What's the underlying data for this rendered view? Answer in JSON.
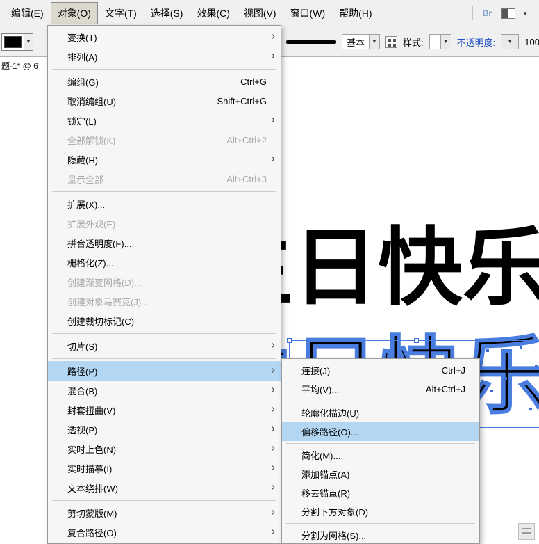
{
  "menubar": {
    "items": [
      {
        "label": "编辑(E)",
        "active": false
      },
      {
        "label": "对象(O)",
        "active": true
      },
      {
        "label": "文字(T)",
        "active": false
      },
      {
        "label": "选择(S)",
        "active": false
      },
      {
        "label": "效果(C)",
        "active": false
      },
      {
        "label": "视图(V)",
        "active": false
      },
      {
        "label": "窗口(W)",
        "active": false
      },
      {
        "label": "帮助(H)",
        "active": false
      }
    ],
    "bridge_label": "Br"
  },
  "control_bar": {
    "brush_name": "基本",
    "style_label": "样式:",
    "opacity_label": "不透明度:",
    "opacity_value": "100"
  },
  "document_tab": {
    "label": "题-1* @ 6"
  },
  "object_menu": {
    "items": [
      {
        "label": "变换(T)",
        "submenu": true
      },
      {
        "label": "排列(A)",
        "submenu": true
      },
      {
        "separator": true
      },
      {
        "label": "编组(G)",
        "shortcut": "Ctrl+G"
      },
      {
        "label": "取消编组(U)",
        "shortcut": "Shift+Ctrl+G"
      },
      {
        "label": "锁定(L)",
        "submenu": true
      },
      {
        "label": "全部解锁(K)",
        "shortcut": "Alt+Ctrl+2",
        "disabled": true
      },
      {
        "label": "隐藏(H)",
        "submenu": true
      },
      {
        "label": "显示全部",
        "shortcut": "Alt+Ctrl+3",
        "disabled": true
      },
      {
        "separator": true
      },
      {
        "label": "扩展(X)..."
      },
      {
        "label": "扩展外观(E)",
        "disabled": true
      },
      {
        "label": "拼合透明度(F)..."
      },
      {
        "label": "栅格化(Z)..."
      },
      {
        "label": "创建渐变网格(D)...",
        "disabled": true
      },
      {
        "label": "创建对象马赛克(J)...",
        "disabled": true
      },
      {
        "label": "创建裁切标记(C)"
      },
      {
        "separator": true
      },
      {
        "label": "切片(S)",
        "submenu": true
      },
      {
        "separator": true
      },
      {
        "label": "路径(P)",
        "submenu": true,
        "highlighted": true
      },
      {
        "label": "混合(B)",
        "submenu": true
      },
      {
        "label": "封套扭曲(V)",
        "submenu": true
      },
      {
        "label": "透视(P)",
        "submenu": true
      },
      {
        "label": "实时上色(N)",
        "submenu": true
      },
      {
        "label": "实时描摹(I)",
        "submenu": true
      },
      {
        "label": "文本绕排(W)",
        "submenu": true
      },
      {
        "separator": true
      },
      {
        "label": "剪切蒙版(M)",
        "submenu": true
      },
      {
        "label": "复合路径(O)",
        "submenu": true
      }
    ]
  },
  "path_submenu": {
    "items": [
      {
        "label": "连接(J)",
        "shortcut": "Ctrl+J"
      },
      {
        "label": "平均(V)...",
        "shortcut": "Alt+Ctrl+J"
      },
      {
        "separator": true
      },
      {
        "label": "轮廓化描边(U)"
      },
      {
        "label": "偏移路径(O)...",
        "highlighted": true
      },
      {
        "separator": true
      },
      {
        "label": "简化(M)..."
      },
      {
        "label": "添加锚点(A)"
      },
      {
        "label": "移去锚点(R)"
      },
      {
        "label": "分割下方对象(D)"
      },
      {
        "separator": true
      },
      {
        "label": "分割为网格(S)..."
      }
    ]
  },
  "canvas": {
    "headline_text": "生日快乐",
    "outline_text": "生日快乐"
  },
  "ui": {
    "dropdown_arrow_glyph": "▼",
    "submenu_arrow_glyph": "›"
  },
  "colors": {
    "menu_highlight": "#b3d7f3",
    "selection_blue": "#4a7de0",
    "link_blue": "#2353c4",
    "bar_background": "#f0f0f0"
  }
}
